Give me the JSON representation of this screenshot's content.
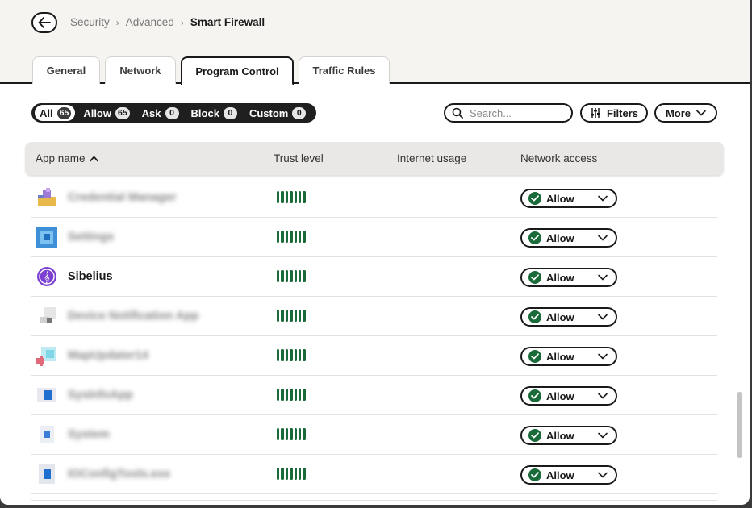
{
  "breadcrumb": {
    "items": [
      "Security",
      "Advanced"
    ],
    "current": "Smart Firewall"
  },
  "tabs": [
    {
      "label": "General",
      "active": false
    },
    {
      "label": "Network",
      "active": false
    },
    {
      "label": "Program Control",
      "active": true
    },
    {
      "label": "Traffic Rules",
      "active": false
    }
  ],
  "filters": [
    {
      "label": "All",
      "count": "65",
      "active": true
    },
    {
      "label": "Allow",
      "count": "65",
      "active": false
    },
    {
      "label": "Ask",
      "count": "0",
      "active": false
    },
    {
      "label": "Block",
      "count": "0",
      "active": false
    },
    {
      "label": "Custom",
      "count": "0",
      "active": false
    }
  ],
  "search": {
    "placeholder": "Search..."
  },
  "toolbar": {
    "filters_label": "Filters",
    "more_label": "More"
  },
  "table": {
    "columns": {
      "app_name": "App name",
      "trust_level": "Trust level",
      "internet_usage": "Internet usage",
      "network_access": "Network access"
    },
    "rows": [
      {
        "name": "Credential Manager",
        "blurred": true,
        "icon": "credential-manager-icon",
        "trust_bars": 7,
        "access": "Allow"
      },
      {
        "name": "Settings",
        "blurred": true,
        "icon": "settings-app-icon",
        "trust_bars": 7,
        "access": "Allow"
      },
      {
        "name": "Sibelius",
        "blurred": false,
        "icon": "sibelius-icon",
        "trust_bars": 7,
        "access": "Allow"
      },
      {
        "name": "Device Notification App",
        "blurred": true,
        "icon": "device-app-icon",
        "trust_bars": 7,
        "access": "Allow"
      },
      {
        "name": "MapUpdater14",
        "blurred": true,
        "icon": "map-updater-icon",
        "trust_bars": 7,
        "access": "Allow"
      },
      {
        "name": "SysInfoApp",
        "blurred": true,
        "icon": "system-info-icon",
        "trust_bars": 7,
        "access": "Allow"
      },
      {
        "name": "System",
        "blurred": true,
        "icon": "system-icon",
        "trust_bars": 7,
        "access": "Allow"
      },
      {
        "name": "IOConfigTools.exe",
        "blurred": true,
        "icon": "io-config-icon",
        "trust_bars": 7,
        "access": "Allow"
      }
    ]
  },
  "colors": {
    "accent_dark": "#1f1f1f",
    "trust_green": "#1a6b3a",
    "header_bg": "#f6f4f1",
    "sibelius_purple": "#7b3fd1"
  }
}
